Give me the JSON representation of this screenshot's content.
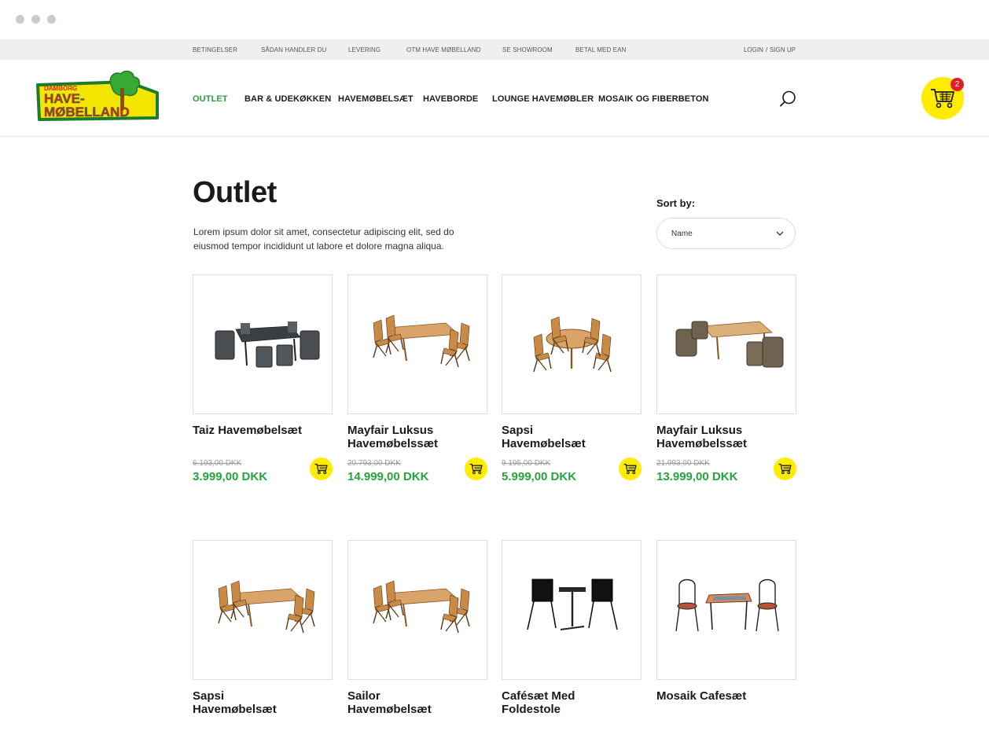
{
  "top_links": [
    "BETINGELSER",
    "SÅDAN HANDLER DU",
    "LEVERING",
    "OTM HAVE MØBELLAND",
    "SE SHOWROOM",
    "BETAL MED EAN"
  ],
  "auth": {
    "login": "LOGIN",
    "separator": "/",
    "signup": "SIGN UP"
  },
  "logo": {
    "top": "DAMBORG",
    "line1": "HAVE-",
    "line2": "MØBELLAND"
  },
  "nav": [
    "OUTLET",
    "BAR & UDEKØKKEN",
    "HAVEMØBELSÆT",
    "HAVEBORDE",
    "LOUNGE HAVEMØBLER",
    "MOSAIK OG FIBERBETON"
  ],
  "cart": {
    "count": "2",
    "icon": "cart-icon"
  },
  "search": {
    "icon": "search-icon"
  },
  "page": {
    "title": "Outlet",
    "intro": "Lorem ipsum dolor sit amet, consectetur adipiscing elit, sed do eiusmod tempor incididunt ut labore et dolore magna aliqua."
  },
  "sort": {
    "label": "Sort by:",
    "value": "Name"
  },
  "products": [
    {
      "name": "Taiz Havemøbelsæt",
      "old_price": "6.193,00 DKK",
      "price": "3.999,00 DKK",
      "style": "dark"
    },
    {
      "name": "Mayfair Luksus Havemøbelssæt",
      "old_price": "20.793,00 DKK",
      "price": "14.999,00 DKK",
      "style": "teak"
    },
    {
      "name": "Sapsi Havemøbelsæt",
      "old_price": "9.195,00 DKK",
      "price": "5.999,00 DKK",
      "style": "teak-round"
    },
    {
      "name": "Mayfair Luksus Havemøbelssæt",
      "old_price": "21.993,00 DKK",
      "price": "13.999,00 DKK",
      "style": "wicker"
    },
    {
      "name": "Sapsi Havemøbelsæt",
      "style": "teak"
    },
    {
      "name": "Sailor Havemøbelsæt",
      "style": "teak"
    },
    {
      "name": "Cafésæt Med Foldestole",
      "style": "black"
    },
    {
      "name": "Mosaik Cafesæt",
      "style": "mosaic"
    }
  ],
  "colors": {
    "accent_green": "#23a43c",
    "cart_yellow": "#ffec00",
    "badge_red": "#e21e2c"
  }
}
